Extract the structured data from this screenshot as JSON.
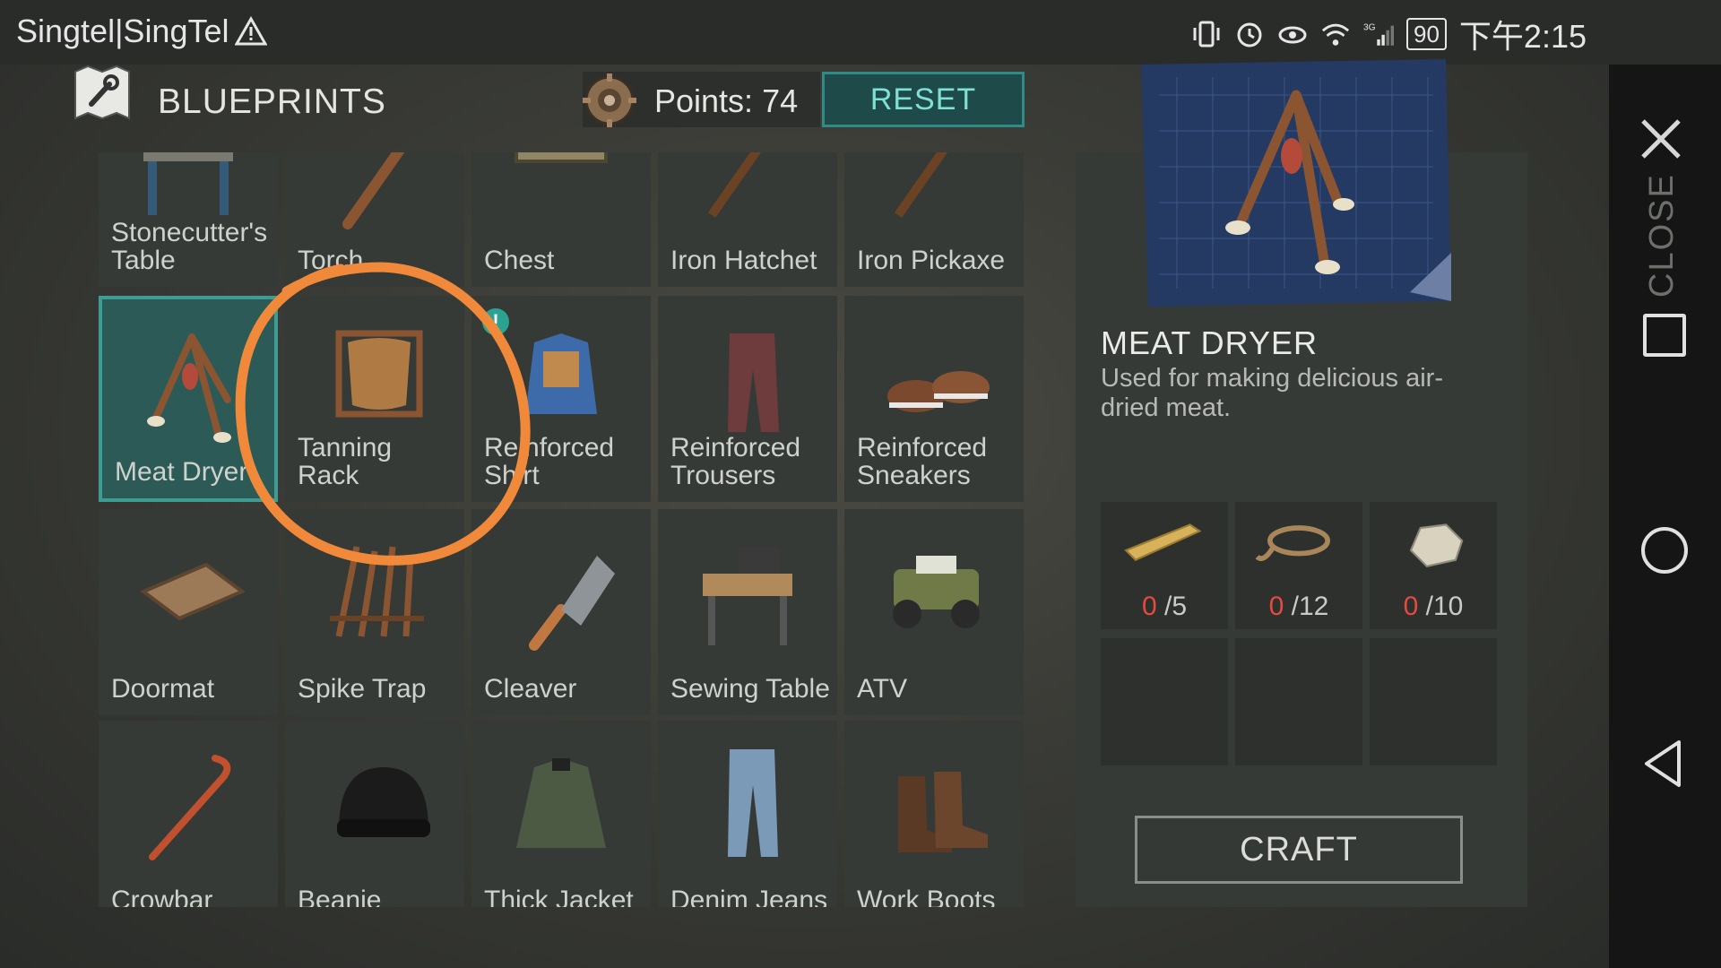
{
  "status_bar": {
    "carrier": "Singtel|SingTel",
    "battery": "90",
    "time": "下午2:15"
  },
  "navbar": {
    "close_label": "CLOSE"
  },
  "header": {
    "title": "BLUEPRINTS",
    "points_label": "Points:",
    "points_value": "74",
    "reset_label": "RESET"
  },
  "grid": {
    "rows": [
      [
        {
          "name": "Stonecutter's Table",
          "icon": "stonecutter-table-icon"
        },
        {
          "name": "Torch",
          "icon": "torch-icon"
        },
        {
          "name": "Chest",
          "icon": "chest-icon"
        },
        {
          "name": "Iron Hatchet",
          "icon": "hatchet-icon"
        },
        {
          "name": "Iron Pickaxe",
          "icon": "pickaxe-icon"
        }
      ],
      [
        {
          "name": "Meat Dryer",
          "icon": "meat-dryer-icon",
          "selected": true
        },
        {
          "name": "Tanning Rack",
          "icon": "tanning-rack-icon"
        },
        {
          "name": "Reinforced Shirt",
          "icon": "vest-icon",
          "badge": "!"
        },
        {
          "name": "Reinforced Trousers",
          "icon": "trousers-icon"
        },
        {
          "name": "Reinforced Sneakers",
          "icon": "sneakers-icon"
        }
      ],
      [
        {
          "name": "Doormat",
          "icon": "doormat-icon"
        },
        {
          "name": "Spike Trap",
          "icon": "spike-trap-icon"
        },
        {
          "name": "Cleaver",
          "icon": "cleaver-icon"
        },
        {
          "name": "Sewing Table",
          "icon": "sewing-table-icon"
        },
        {
          "name": "ATV",
          "icon": "atv-icon"
        }
      ],
      [
        {
          "name": "Crowbar",
          "icon": "crowbar-icon"
        },
        {
          "name": "Beanie",
          "icon": "beanie-icon"
        },
        {
          "name": "Thick Jacket",
          "icon": "jacket-icon"
        },
        {
          "name": "Denim Jeans",
          "icon": "jeans-icon"
        },
        {
          "name": "Work Boots",
          "icon": "boots-icon"
        }
      ]
    ]
  },
  "detail": {
    "name": "MEAT DRYER",
    "description": "Used for making delicious air-dried meat.",
    "ingredients": [
      {
        "icon": "plank-icon",
        "have": "0",
        "need": "/5"
      },
      {
        "icon": "rope-icon",
        "have": "0",
        "need": "/12"
      },
      {
        "icon": "stone-icon",
        "have": "0",
        "need": "/10"
      }
    ],
    "craft_label": "CRAFT"
  },
  "colors": {
    "accent": "#2f8b86",
    "selected_bg": "#2c5a57",
    "missing_count": "#e44a3f",
    "annotation": "#f08a3a"
  }
}
